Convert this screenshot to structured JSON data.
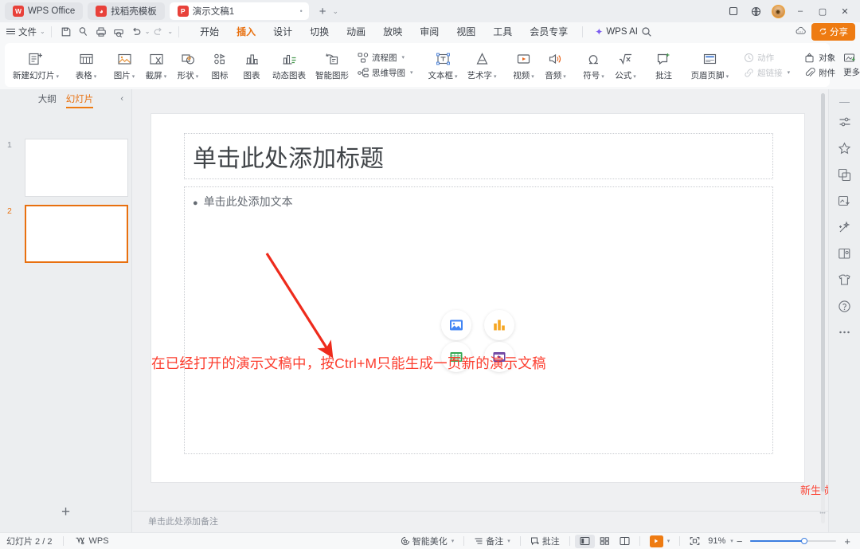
{
  "window": {
    "tabs": [
      {
        "label": "WPS Office",
        "icon": "wps-logo-icon",
        "kind": "w",
        "active": false
      },
      {
        "label": "找稻壳模板",
        "icon": "docer-icon",
        "kind": "d",
        "active": false
      },
      {
        "label": "演示文稿1",
        "icon": "presentation-icon",
        "kind": "p",
        "active": true
      }
    ],
    "new_tab_label": "+",
    "tab_list_caret": "⌄",
    "controls": {
      "multiwindow": "❐",
      "globe": "◍",
      "avatar": "",
      "minimize": "–",
      "maximize": "▢",
      "close": "✕"
    }
  },
  "menubar": {
    "file_label": "文件",
    "quick_access": [
      {
        "name": "save-icon",
        "dim": false
      },
      {
        "name": "search-doc-icon",
        "dim": false
      },
      {
        "name": "print-icon",
        "dim": false
      },
      {
        "name": "print-preview-icon",
        "dim": false
      },
      {
        "name": "undo-icon",
        "dim": false
      },
      {
        "name": "redo-icon",
        "dim": true
      }
    ],
    "items": [
      {
        "label": "开始",
        "active": false
      },
      {
        "label": "插入",
        "active": true
      },
      {
        "label": "设计",
        "active": false
      },
      {
        "label": "切换",
        "active": false
      },
      {
        "label": "动画",
        "active": false
      },
      {
        "label": "放映",
        "active": false
      },
      {
        "label": "审阅",
        "active": false
      },
      {
        "label": "视图",
        "active": false
      },
      {
        "label": "工具",
        "active": false
      },
      {
        "label": "会员专享",
        "active": false
      }
    ],
    "ai_label": "WPS AI",
    "search_icon": "search-icon",
    "cloud_icon": "cloud-sync-icon",
    "share_label": "分享"
  },
  "ribbon": {
    "groups": [
      {
        "items": [
          {
            "label": "新建幻灯片",
            "icon": "new-slide-icon",
            "caret": true,
            "dim": false
          }
        ]
      },
      {
        "items": [
          {
            "label": "表格",
            "icon": "table-icon",
            "caret": true,
            "dim": false
          }
        ]
      },
      {
        "items": [
          {
            "label": "图片",
            "icon": "picture-icon",
            "caret": true,
            "dim": false
          },
          {
            "label": "截屏",
            "icon": "screenshot-icon",
            "caret": true,
            "dim": false
          },
          {
            "label": "形状",
            "icon": "shape-icon",
            "caret": true,
            "dim": false
          },
          {
            "label": "图标",
            "icon": "icon-library-icon",
            "caret": false,
            "dim": false
          },
          {
            "label": "图表",
            "icon": "chart-icon",
            "caret": false,
            "dim": false
          },
          {
            "label": "动态图表",
            "icon": "dynamic-chart-icon",
            "caret": false,
            "dim": false
          },
          {
            "label": "智能图形",
            "icon": "smart-graphic-icon",
            "caret": false,
            "dim": false
          }
        ]
      },
      {
        "stack": [
          {
            "label": "流程图",
            "icon": "flowchart-icon",
            "caret": true,
            "dim": false
          },
          {
            "label": "思维导图",
            "icon": "mindmap-icon",
            "caret": true,
            "dim": false
          }
        ]
      },
      {
        "items": [
          {
            "label": "文本框",
            "icon": "textbox-icon",
            "caret": true,
            "dim": false
          },
          {
            "label": "艺术字",
            "icon": "wordart-icon",
            "caret": true,
            "dim": false
          }
        ]
      },
      {
        "items": [
          {
            "label": "视频",
            "icon": "video-icon",
            "caret": true,
            "dim": false
          },
          {
            "label": "音频",
            "icon": "audio-icon",
            "caret": true,
            "dim": false
          }
        ]
      },
      {
        "items": [
          {
            "label": "符号",
            "icon": "symbol-icon",
            "caret": true,
            "dim": false
          },
          {
            "label": "公式",
            "icon": "formula-icon",
            "caret": true,
            "dim": false
          }
        ]
      },
      {
        "items": [
          {
            "label": "批注",
            "icon": "comment-icon",
            "caret": false,
            "dim": false
          }
        ]
      },
      {
        "items": [
          {
            "label": "页眉页脚",
            "icon": "header-footer-icon",
            "caret": true,
            "dim": false
          }
        ]
      },
      {
        "stack": [
          {
            "label": "动作",
            "icon": "action-icon",
            "caret": false,
            "dim": true
          },
          {
            "label": "超链接",
            "icon": "hyperlink-icon",
            "caret": true,
            "dim": true
          }
        ]
      },
      {
        "stack": [
          {
            "label": "对象",
            "icon": "object-icon",
            "caret": false,
            "dim": false
          },
          {
            "label": "附件",
            "icon": "attachment-icon",
            "caret": false,
            "dim": false
          }
        ]
      },
      {
        "stack": [
          {
            "label": "",
            "icon": "more-material-top-icon",
            "caret": false,
            "dim": false
          },
          {
            "label": "更多素材",
            "icon": "more-material-icon",
            "caret": true,
            "dim": false
          }
        ]
      }
    ]
  },
  "slide_panel": {
    "tab_outline": "大纲",
    "tab_slides": "幻灯片",
    "collapse_icon": "chevron-left-icon",
    "thumbnails": [
      {
        "number": "1",
        "selected": false
      },
      {
        "number": "2",
        "selected": true
      }
    ],
    "add_slide_label": "+"
  },
  "slide": {
    "title_placeholder": "单击此处添加标题",
    "body_placeholder": "单击此处添加文本",
    "bullet": "●",
    "insert_icons": [
      {
        "name": "insert-picture-icon",
        "color": "#4285f4"
      },
      {
        "name": "insert-chart-icon",
        "color": "#f5a623"
      },
      {
        "name": "insert-table-icon",
        "color": "#34a853"
      },
      {
        "name": "insert-video-icon",
        "color": "#6a3fa0"
      }
    ],
    "notes_placeholder": "单击此处添加备注"
  },
  "annotations": {
    "text_main": "在已经打开的演示文稿中，按Ctrl+M只能生成一页新的演示文稿",
    "text_callout": "新生成的页面",
    "arrow_color": "#ee2b1c",
    "text_color": "#fc3d2e"
  },
  "right_rail": {
    "icons": [
      "collapse-dash-icon",
      "slide-settings-icon",
      "favorites-star-icon",
      "layers-icon",
      "resource-download-icon",
      "beautify-magic-icon",
      "book-reader-icon",
      "template-shirt-icon",
      "help-circle-icon",
      "more-dots-icon"
    ]
  },
  "statusbar": {
    "slide_count": "幻灯片 2 / 2",
    "app_mark": "WPS",
    "app_mark_icon": "wps-badge-icon",
    "beautify_label": "智能美化",
    "notes_label": "备注",
    "comment_label": "批注",
    "view_normal_icon": "view-normal-icon",
    "view_sorter_icon": "view-sorter-icon",
    "view_reading_icon": "view-reading-icon",
    "play_icon": "play-icon",
    "fit_icon": "fit-to-window-icon",
    "zoom_level": "91%",
    "zoom_out": "−",
    "zoom_in": "+"
  }
}
